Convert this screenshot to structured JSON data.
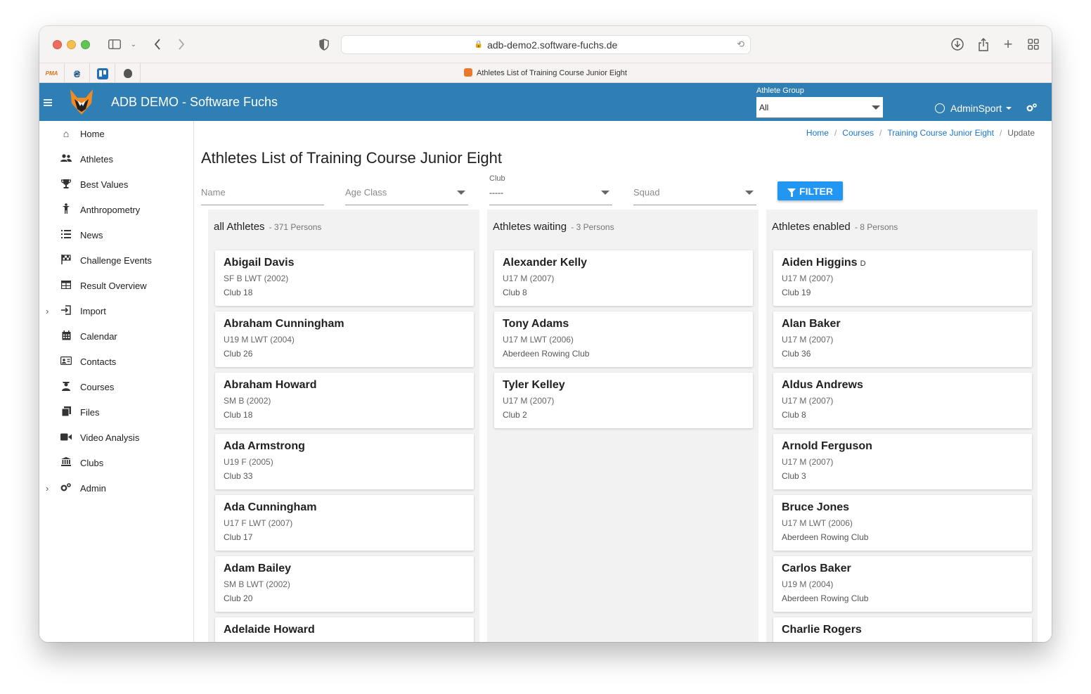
{
  "browser": {
    "url": "adb-demo2.software-fuchs.de",
    "tab_title": "Athletes List of Training Course Junior Eight",
    "pinned_tabs": [
      "pma",
      "favicon-2",
      "trello",
      "apple"
    ]
  },
  "app": {
    "title": "ADB DEMO - Software Fuchs",
    "athlete_group_label": "Athlete Group",
    "athlete_group_value": "All",
    "user_name": "AdminSport",
    "brand_color": "#2f7fb5"
  },
  "sidebar": {
    "items": [
      {
        "label": "Home",
        "icon": "home-icon",
        "chevron": false
      },
      {
        "label": "Athletes",
        "icon": "users-icon",
        "chevron": false
      },
      {
        "label": "Best Values",
        "icon": "trophy-icon",
        "chevron": false
      },
      {
        "label": "Anthropometry",
        "icon": "person-icon",
        "chevron": false
      },
      {
        "label": "News",
        "icon": "list-icon",
        "chevron": false
      },
      {
        "label": "Challenge Events",
        "icon": "flag-checkered-icon",
        "chevron": false
      },
      {
        "label": "Result Overview",
        "icon": "table-icon",
        "chevron": false
      },
      {
        "label": "Import",
        "icon": "import-icon",
        "chevron": true
      },
      {
        "label": "Calendar",
        "icon": "calendar-icon",
        "chevron": false
      },
      {
        "label": "Contacts",
        "icon": "contact-card-icon",
        "chevron": false
      },
      {
        "label": "Courses",
        "icon": "graduation-icon",
        "chevron": false
      },
      {
        "label": "Files",
        "icon": "files-icon",
        "chevron": false
      },
      {
        "label": "Video Analysis",
        "icon": "video-icon",
        "chevron": false
      },
      {
        "label": "Clubs",
        "icon": "bank-icon",
        "chevron": false
      },
      {
        "label": "Admin",
        "icon": "cogs-icon",
        "chevron": true
      }
    ]
  },
  "breadcrumb": {
    "home": "Home",
    "courses": "Courses",
    "course": "Training Course Junior Eight",
    "current": "Update",
    "sep": "/"
  },
  "page": {
    "title": "Athletes List of Training Course Junior Eight"
  },
  "filters": {
    "name_placeholder": "Name",
    "age_class_placeholder": "Age Class",
    "club_label": "Club",
    "club_value": "-----",
    "squad_placeholder": "Squad",
    "filter_button": "FILTER"
  },
  "columns": {
    "all": {
      "title": "all Athletes",
      "count": "- 371 Persons",
      "cards": [
        {
          "name": "Abigail Davis",
          "flag": "",
          "line1": "SF B LWT (2002)",
          "line2": "Club 18"
        },
        {
          "name": "Abraham Cunningham",
          "flag": "",
          "line1": "U19 M LWT (2004)",
          "line2": "Club 26"
        },
        {
          "name": "Abraham Howard",
          "flag": "",
          "line1": "SM B (2002)",
          "line2": "Club 18"
        },
        {
          "name": "Ada Armstrong",
          "flag": "",
          "line1": "U19 F (2005)",
          "line2": "Club 33"
        },
        {
          "name": "Ada Cunningham",
          "flag": "",
          "line1": "U17 F LWT (2007)",
          "line2": "Club 17"
        },
        {
          "name": "Adam Bailey",
          "flag": "",
          "line1": "SM B LWT (2002)",
          "line2": "Club 20"
        },
        {
          "name": "Adelaide Howard",
          "flag": "",
          "line1": "",
          "line2": ""
        }
      ]
    },
    "waiting": {
      "title": "Athletes waiting",
      "count": "- 3 Persons",
      "cards": [
        {
          "name": "Alexander Kelly",
          "flag": "",
          "line1": "U17 M (2007)",
          "line2": "Club 8"
        },
        {
          "name": "Tony Adams",
          "flag": "",
          "line1": "U17 M LWT (2006)",
          "line2": "Aberdeen Rowing Club"
        },
        {
          "name": "Tyler Kelley",
          "flag": "",
          "line1": "U17 M (2007)",
          "line2": "Club 2"
        }
      ]
    },
    "enabled": {
      "title": "Athletes enabled",
      "count": "- 8 Persons",
      "cards": [
        {
          "name": "Aiden Higgins",
          "flag": "D",
          "line1": "U17 M (2007)",
          "line2": "Club 19"
        },
        {
          "name": "Alan Baker",
          "flag": "",
          "line1": "U17 M (2007)",
          "line2": "Club 36"
        },
        {
          "name": "Aldus Andrews",
          "flag": "",
          "line1": "U17 M (2007)",
          "line2": "Club 8"
        },
        {
          "name": "Arnold Ferguson",
          "flag": "",
          "line1": "U17 M (2007)",
          "line2": "Club 3"
        },
        {
          "name": "Bruce Jones",
          "flag": "",
          "line1": "U17 M LWT (2006)",
          "line2": "Aberdeen Rowing Club"
        },
        {
          "name": "Carlos Baker",
          "flag": "",
          "line1": "U19 M (2004)",
          "line2": "Aberdeen Rowing Club"
        },
        {
          "name": "Charlie Rogers",
          "flag": "",
          "line1": "",
          "line2": ""
        }
      ]
    }
  }
}
